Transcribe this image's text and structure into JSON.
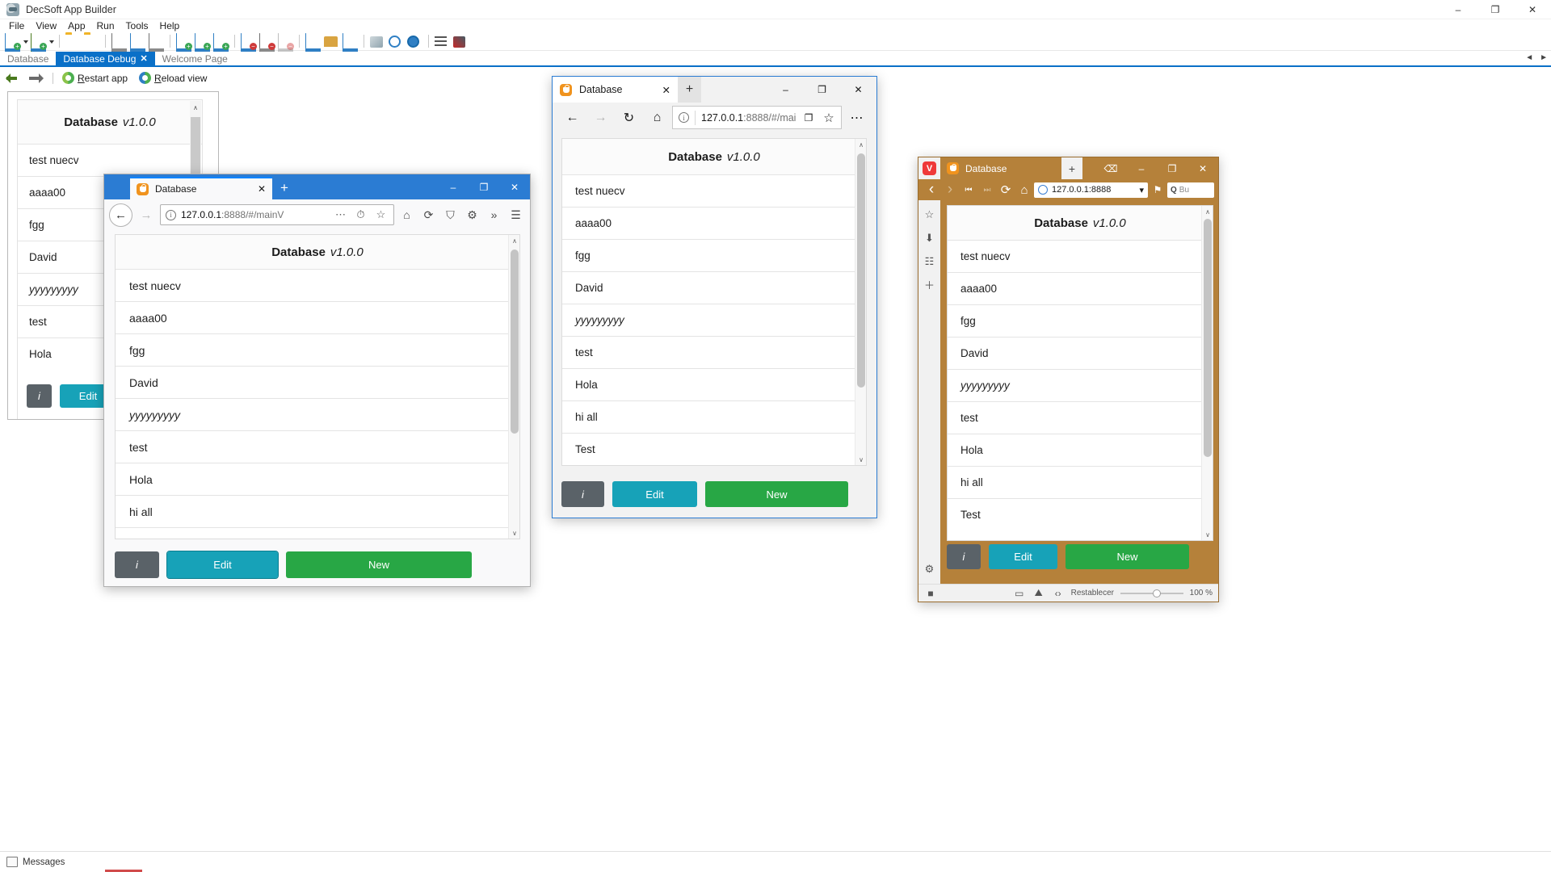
{
  "ide": {
    "title": "DecSoft App Builder",
    "app_icon": "app-builder-icon",
    "window_buttons": {
      "minimize": "–",
      "maximize": "❐",
      "close": "✕"
    },
    "menu": [
      "File",
      "View",
      "App",
      "Run",
      "Tools",
      "Help"
    ],
    "tabs": [
      {
        "label": "Database",
        "active": false,
        "closable": false
      },
      {
        "label": "Database Debug",
        "active": true,
        "closable": true,
        "close_glyph": "✕"
      },
      {
        "label": "Welcome Page",
        "active": false,
        "closable": false
      }
    ],
    "tabs_scroll": {
      "left": "◄",
      "right": "►"
    },
    "debug_toolbar": {
      "back_arrow": "←",
      "forward_arrow": "→",
      "restart_label_pre": "R",
      "restart_label_post": "estart app",
      "reload_label_pre": "R",
      "reload_label_post": "eload view"
    },
    "status": {
      "messages_label": "Messages"
    }
  },
  "app": {
    "title_name": "Database",
    "title_version": "v1.0.0",
    "buttons": {
      "info": "i",
      "edit": "Edit",
      "new": "New"
    },
    "colors": {
      "info": "#5a6268",
      "edit": "#17a2b8",
      "new": "#28a745"
    },
    "records": [
      "test nuecv",
      "aaaa00",
      "fgg",
      "David",
      "yyyyyyyyy",
      "test",
      "Hola",
      "hi all",
      "Test"
    ]
  },
  "ide_preview": {
    "visible_records": [
      "test nuecv",
      "aaaa00",
      "fgg",
      "David",
      "yyyyyyyyy",
      "test",
      "Hola"
    ],
    "scroll_up": "∧",
    "scroll_down": "∨"
  },
  "firefox": {
    "tab": {
      "title": "Database",
      "favicon": "database-app-favicon",
      "close": "✕"
    },
    "new_tab": "+",
    "window_buttons": {
      "minimize": "–",
      "maximize": "❐",
      "close": "✕"
    },
    "nav": {
      "back": "←",
      "forward": "→"
    },
    "url": {
      "host": "127.0.0.1",
      "rest": ":8888/#/mainV"
    },
    "url_icons": [
      "more-dots-icon",
      "pocket-icon",
      "bookmark-star-icon"
    ],
    "toolbar_icons": [
      "home-icon",
      "reload-icon",
      "shield-icon",
      "settings-gear-icon",
      "chevron-double-icon",
      "hamburger-menu-icon"
    ],
    "toolbar_glyphs": {
      "home": "⌂",
      "reload": "⟳",
      "shield": "⛉",
      "gear": "⚙",
      "overflow": "»",
      "menu": "☰"
    },
    "visible_records": [
      "test nuecv",
      "aaaa00",
      "fgg",
      "David",
      "yyyyyyyyy",
      "test",
      "Hola",
      "hi all"
    ],
    "scroll_up": "∧",
    "scroll_down": "∨"
  },
  "edge": {
    "tab": {
      "title": "Database",
      "favicon": "database-app-favicon",
      "close": "✕"
    },
    "new_tab": "+",
    "window_buttons": {
      "minimize": "–",
      "maximize": "❐",
      "close": "✕"
    },
    "nav": {
      "back": "←",
      "forward": "→",
      "refresh": "↻",
      "home": "⌂"
    },
    "url": {
      "host": "127.0.0.1",
      "rest": ":8888/#/mai"
    },
    "url_icons": [
      "reading-view-icon",
      "favorite-star-icon"
    ],
    "url_glyphs": {
      "reading": "❐",
      "star": "☆"
    },
    "more_icon": "⋯",
    "visible_records": [
      "test nuecv",
      "aaaa00",
      "fgg",
      "David",
      "yyyyyyyyy",
      "test",
      "Hola",
      "hi all",
      "Test"
    ],
    "scroll_up": "∧",
    "scroll_down": "∨"
  },
  "vivaldi": {
    "logo": "V",
    "tab": {
      "title": "Database",
      "favicon": "database-app-favicon"
    },
    "new_tab": "+",
    "window_buttons": {
      "trash": "Ὕ1",
      "minimize": "–",
      "maximize": "❐",
      "close": "✕"
    },
    "trash_glyph": "⌫",
    "nav": {
      "back": "‹",
      "forward": "›",
      "first": "⏮",
      "last": "⏭",
      "reload": "⟳",
      "home": "⌂"
    },
    "url": "127.0.0.1:8888",
    "url_dropdown": "▾",
    "bookmark_glyph": "⚑",
    "search_placeholder": "Bu",
    "search_icon": "Q",
    "panel_icons": [
      "bookmarks-panel-icon",
      "downloads-panel-icon",
      "notes-panel-icon",
      "add-panel-icon",
      "settings-panel-icon"
    ],
    "panel_glyphs": {
      "bookmarks": "☆",
      "downloads": "⬇",
      "notes": "☷",
      "add": "＋",
      "settings": "⚙"
    },
    "visible_records": [
      "test nuecv",
      "aaaa00",
      "fgg",
      "David",
      "yyyyyyyyy",
      "test",
      "Hola",
      "hi all",
      "Test"
    ],
    "status": {
      "zoom_label": "100 %",
      "reset_label": "Restablecer"
    },
    "status_glyphs": {
      "tiling": "■",
      "capture": "▭",
      "image": "⛰",
      "devtools": "‹›"
    },
    "scroll_up": "∧",
    "scroll_down": "∨"
  }
}
